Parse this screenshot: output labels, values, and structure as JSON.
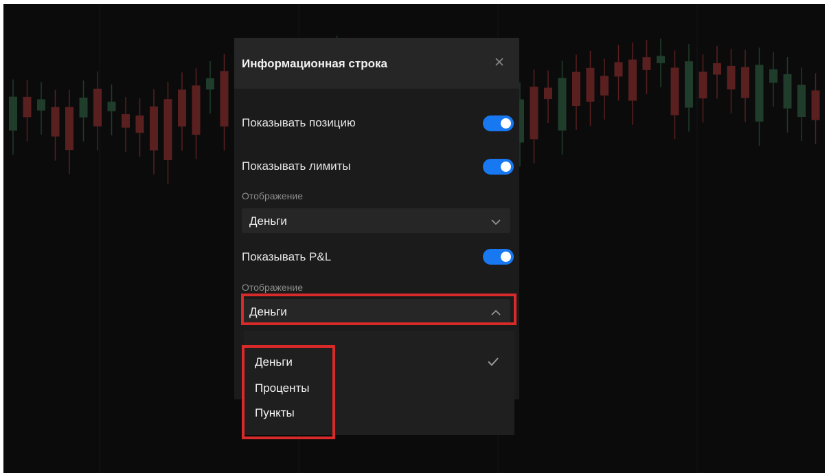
{
  "dialog": {
    "title": "Информационная строка",
    "close_icon": "close-icon"
  },
  "settings": {
    "show_position": {
      "label": "Показывать позицию",
      "enabled": true
    },
    "show_limits": {
      "label": "Показывать лимиты",
      "enabled": true,
      "display_label": "Отображение",
      "display_value": "Деньги"
    },
    "show_pnl": {
      "label": "Показывать P&L",
      "enabled": true,
      "display_label": "Отображение",
      "display_value": "Деньги"
    }
  },
  "dropdown": {
    "options": [
      "Деньги",
      "Проценты",
      "Пункты"
    ],
    "selected": "Деньги"
  },
  "colors": {
    "toggle_on": "#1778f2",
    "highlight": "#d92a2a",
    "candle_up": "#1f3d2a",
    "candle_down": "#5a1f1f"
  }
}
